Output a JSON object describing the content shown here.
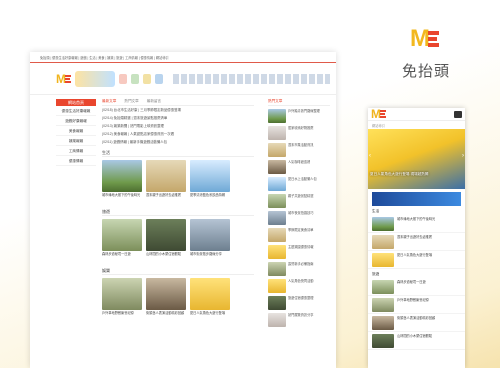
{
  "brand": {
    "name": "免抬頭"
  },
  "desktop": {
    "topbar": "免抬頭 | 優惠生活好康報報 | 遊戲 | 生活 | 美食 | 娛樂 | 旅遊 | 工商情報 | 優惠情報 | 網站導引",
    "left_nav": {
      "header": "網站首頁",
      "items": [
        "優惠生活好康報報",
        "遊戲好康報報",
        "美食報報",
        "娛樂報報",
        "工商情報",
        "優惠情報"
      ]
    },
    "tabs": [
      "最新文章",
      "熱門文章",
      "最新留言"
    ],
    "news": [
      "(02/15) 台北市生活好康 | 三月季節限定新品優惠登場",
      "(02/14) 免抬頭精選 | 週末旅遊景點推薦清單",
      "(02/13) 娛樂新聞 | 熱門電影上映資訊整理",
      "(02/12) 美食報報 | 人氣甜點店家優惠資訊一次看",
      "(02/11) 遊戲情報 | 最新手機遊戲活動懶人包"
    ],
    "sections": [
      {
        "title": "生活",
        "cards": [
          {
            "caption": "城市綠地大樹下的午後時光"
          },
          {
            "caption": "週末親子出遊好去處推薦"
          },
          {
            "caption": "夏季清涼藍色系飲品特輯"
          }
        ]
      },
      {
        "title": "旅遊",
        "cards": [
          {
            "caption": "森林步道秘境一日遊"
          },
          {
            "caption": "山林間的小木屋住宿體驗"
          },
          {
            "caption": "城市街景散步路線分享"
          }
        ]
      },
      {
        "title": "娛樂",
        "cards": [
          {
            "caption": "戶外草地野餐聚會紀錄"
          },
          {
            "caption": "街頭藝人表演活動精彩回顧"
          },
          {
            "caption": "夏日人氣角色大遊行登場"
          }
        ]
      }
    ],
    "sidebar": {
      "header": "熱門文章",
      "items": [
        "戶外踏青熱門路線整理",
        "居家收納好物推薦",
        "週末市集活動資訊",
        "人氣咖啡廳巡禮",
        "夏日水上活動懶人包",
        "親子共遊景點精選",
        "城市夜景拍攝技巧",
        "季節限定美食清單",
        "主題樂園優惠情報",
        "露營新手必備指南",
        "人氣角色快閃活動",
        "旅遊住宿優惠整理",
        "熱門展覽資訊分享"
      ]
    }
  },
  "mobile": {
    "subtitle": "網站導引",
    "hero_caption": "夏日人氣角色大遊行登場 現場超熱鬧",
    "section1": "生活",
    "section2": "旅遊",
    "items": [
      "城市綠地大樹下的午後時光",
      "週末親子出遊好去處推薦",
      "夏日人氣角色大遊行登場",
      "森林步道秘境一日遊",
      "戶外草地野餐聚會紀錄",
      "街頭藝人表演活動精彩回顧",
      "山林間的小木屋住宿體驗"
    ]
  }
}
